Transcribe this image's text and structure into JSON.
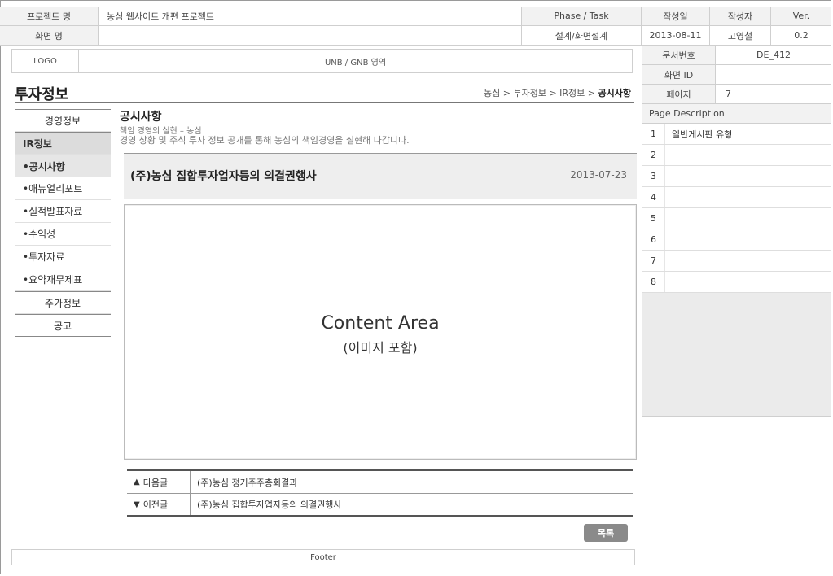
{
  "header": {
    "project_label": "프로젝트 명",
    "project_value": "농심 웹사이트 개편 프로젝트",
    "phase_label": "Phase / Task",
    "date_label": "작성일",
    "author_label": "작성자",
    "ver_label": "Ver.",
    "screen_label": "화면 명",
    "screen_value": "",
    "phase_value": "설계/화면설계",
    "date_value": "2013-08-11",
    "author_value": "고영철",
    "ver_value": "0.2"
  },
  "info": {
    "doc_no_label": "문서번호",
    "doc_no_value": "DE_412",
    "screen_id_label": "화면 ID",
    "screen_id_value": "",
    "page_label": "페이지",
    "page_value": "7"
  },
  "page_description": {
    "title": "Page Description",
    "rows": [
      {
        "num": "1",
        "text": "일반게시판 유형"
      },
      {
        "num": "2",
        "text": ""
      },
      {
        "num": "3",
        "text": ""
      },
      {
        "num": "4",
        "text": ""
      },
      {
        "num": "5",
        "text": ""
      },
      {
        "num": "6",
        "text": ""
      },
      {
        "num": "7",
        "text": ""
      },
      {
        "num": "8",
        "text": ""
      }
    ]
  },
  "topbar": {
    "logo": "LOGO",
    "unb": "UNB / GNB 영역"
  },
  "section": {
    "title": "투자정보",
    "breadcrumb_prefix": "농심 > 투자정보 > IR정보 > ",
    "breadcrumb_current": "공시사항"
  },
  "nav": {
    "cat1": "경영정보",
    "cat2": "IR정보",
    "subs": [
      "•공시사항",
      "•애뉴얼리포트",
      "•실적발표자료",
      "•수익성",
      "•투자자료",
      "•요약재무제표"
    ],
    "cat3": "주가정보",
    "cat4": "공고"
  },
  "content": {
    "title": "공시사항",
    "subtitle": "책임 경영의 실현 – 농심",
    "description": "경영 상황 및 주식 투자 정보 공개를 통해 농심의 책임경영을 실현해 나갑니다.",
    "post_title": "(주)농심 집합투자업자등의 의결권행사",
    "post_date": "2013-07-23",
    "area_line1": "Content Area",
    "area_line2": "(이미지 포함)"
  },
  "post_nav": {
    "next_label": "다음글",
    "next_title": "(주)농심 정기주주총회결과",
    "prev_label": "이전글",
    "prev_title": "(주)농심 집합투자업자등의 의결권행사"
  },
  "list_button": "목록",
  "footer": "Footer"
}
